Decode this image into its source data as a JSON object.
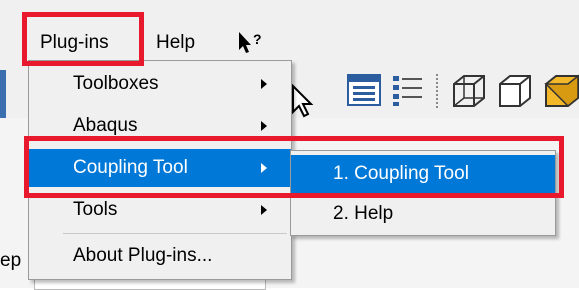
{
  "menubar": {
    "plugins_label": "Plug-ins",
    "help_label": "Help",
    "whats_this_icon": "whats-this-cursor-icon"
  },
  "toolbar": {
    "icons": [
      "pointer-arrow-icon",
      "table-window-icon",
      "list-icon",
      "wireframe-cube-icon",
      "outline-cube-icon",
      "shaded-cube-icon"
    ]
  },
  "plugins_menu": {
    "items": [
      {
        "label": "Toolboxes",
        "has_submenu": true
      },
      {
        "label": "Abaqus",
        "has_submenu": true
      },
      {
        "label": "Coupling Tool",
        "has_submenu": true,
        "highlighted": true
      },
      {
        "label": "Tools",
        "has_submenu": true
      },
      {
        "label": "About Plug-ins...",
        "has_submenu": false
      }
    ]
  },
  "coupling_submenu": {
    "items": [
      {
        "label": "1. Coupling Tool",
        "highlighted": true
      },
      {
        "label": "2. Help"
      }
    ]
  },
  "background": {
    "partial_label": "ep"
  },
  "colors": {
    "selection": "#0078d7",
    "annotation": "#e8192c",
    "menu_bg": "#f0f0f0"
  }
}
